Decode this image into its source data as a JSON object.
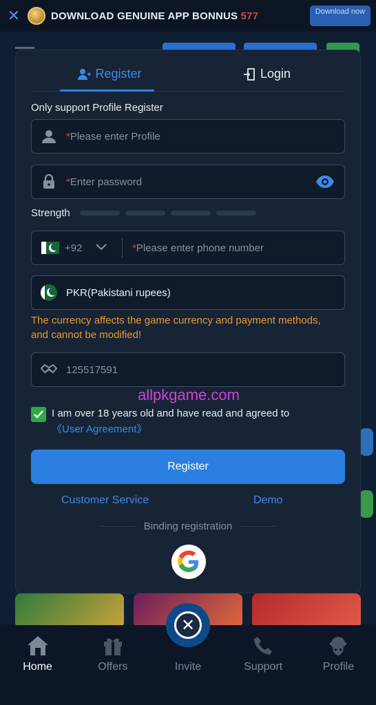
{
  "banner": {
    "title_main": "DOWNLOAD  GENUINE APP BONNUS ",
    "title_num": "577",
    "download_label": "Download now"
  },
  "modal": {
    "tabs": [
      {
        "label": "Register",
        "active": true
      },
      {
        "label": "Login",
        "active": false
      }
    ],
    "support_text": "Only support Profile Register",
    "profile": {
      "required": "*",
      "placeholder": "Please enter Profile"
    },
    "password": {
      "required": "*",
      "placeholder": "Enter password"
    },
    "strength_label": "Strength",
    "phone": {
      "country_code": "+92",
      "required": "*",
      "placeholder": "Please enter phone number"
    },
    "currency": {
      "value": "PKR(Pakistani rupees)"
    },
    "currency_warning": "The currency affects the game currency and payment methods, and cannot be modified!",
    "referral": {
      "value": "125517591"
    },
    "watermark": "allpkgame.com",
    "agreement": {
      "text": "I am over 18 years old and have read and agreed to",
      "link": "《User Agreement》",
      "checked": true
    },
    "register_button": "Register",
    "customer_service": "Customer Service",
    "demo": "Demo",
    "binding_label": "Binding registration"
  },
  "nav": {
    "items": [
      {
        "label": "Home",
        "icon": "home-icon"
      },
      {
        "label": "Offers",
        "icon": "gift-icon"
      },
      {
        "label": "Invite",
        "icon": "invite-icon"
      },
      {
        "label": "Support",
        "icon": "phone-icon"
      },
      {
        "label": "Profile",
        "icon": "profile-icon"
      }
    ]
  },
  "colors": {
    "accent": "#2a7fe0",
    "warning": "#e89a2b",
    "required": "#e0453f",
    "check": "#2ea84a"
  }
}
